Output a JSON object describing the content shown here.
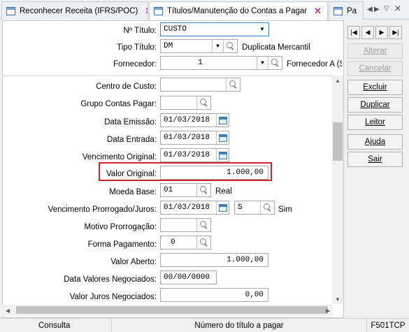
{
  "tabs": [
    {
      "label": "Reconhecer Receita (IFRS/POC)"
    },
    {
      "label": "Títulos/Manutenção do Contas a Pagar"
    },
    {
      "label": "Pa"
    }
  ],
  "form": {
    "numero_titulo": {
      "label": "Nº Título:",
      "value": "CUSTO"
    },
    "tipo_titulo": {
      "label": "Tipo Título:",
      "value": "DM",
      "desc": "Duplicata Mercantil"
    },
    "fornecedor": {
      "label": "Fornecedor:",
      "value": "1",
      "desc": "Fornecedor A (S"
    },
    "centro_custo": {
      "label": "Centro de Custo:",
      "value": ""
    },
    "grupo_contas": {
      "label": "Grupo Contas Pagar:",
      "value": ""
    },
    "data_emissao": {
      "label": "Data Emissão:",
      "value": "01/03/2018"
    },
    "data_entrada": {
      "label": "Data Entrada:",
      "value": "01/03/2018"
    },
    "vencimento_original": {
      "label": "Vencimento Original:",
      "value": "01/03/2018"
    },
    "valor_original": {
      "label": "Valor Original:",
      "value": "1.000,00"
    },
    "moeda_base": {
      "label": "Moeda Base:",
      "value": "01",
      "desc": "Real"
    },
    "vencimento_prorrogado": {
      "label": "Vencimento Prorrogado/Juros:",
      "value": "01/03/2018",
      "flag": "S",
      "flag_desc": "Sim"
    },
    "motivo_prorrogacao": {
      "label": "Motivo Prorrogação:",
      "value": ""
    },
    "forma_pagamento": {
      "label": "Forma Pagamento:",
      "value": "0"
    },
    "valor_aberto": {
      "label": "Valor Aberto:",
      "value": "1.000,00"
    },
    "data_valores_negociados": {
      "label": "Data Valores Negociados:",
      "value": "00/00/0000"
    },
    "valor_juros_negociados": {
      "label": "Valor Juros Negociados:",
      "value": "0,00"
    }
  },
  "actions": {
    "alterar": "Alterar",
    "cancelar": "Cancelar",
    "excluir": "Excluir",
    "duplicar": "Duplicar",
    "leitor": "Leitor",
    "ajuda": "Ajuda",
    "sair": "Sair"
  },
  "nav": {
    "first": "|◀",
    "prev": "◀",
    "next": "▶",
    "last": "▶|"
  },
  "status": {
    "mode": "Consulta",
    "hint": "Número do título a pagar",
    "code": "F501TCP"
  }
}
